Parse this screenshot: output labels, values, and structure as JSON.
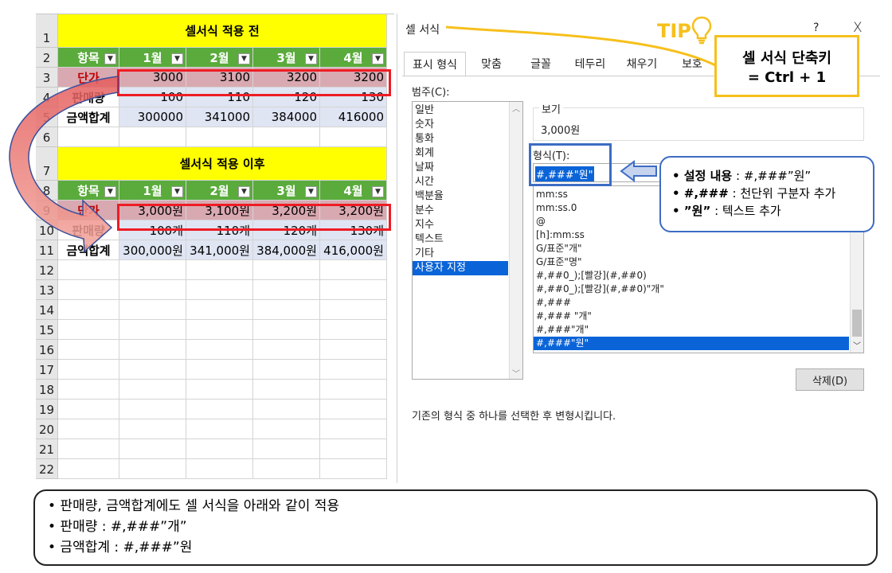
{
  "sheet": {
    "rows": [
      "1",
      "2",
      "3",
      "4",
      "5",
      "6",
      "7",
      "8",
      "9",
      "10",
      "11",
      "12",
      "13",
      "14",
      "15",
      "16",
      "17",
      "18",
      "19",
      "20",
      "21",
      "22"
    ],
    "before": {
      "title": "셀서식 적용 전",
      "headers": [
        "항목",
        "1월",
        "2월",
        "3월",
        "4월"
      ],
      "rows": [
        [
          "단가",
          "3000",
          "3100",
          "3200",
          "3200"
        ],
        [
          "판매량",
          "100",
          "110",
          "120",
          "130"
        ],
        [
          "금액합계",
          "300000",
          "341000",
          "384000",
          "416000"
        ]
      ]
    },
    "after": {
      "title": "셀서식 적용 이후",
      "headers": [
        "항목",
        "1월",
        "2월",
        "3월",
        "4월"
      ],
      "rows": [
        [
          "단가",
          "3,000원",
          "3,100원",
          "3,200원",
          "3,200원"
        ],
        [
          "판매량",
          "100개",
          "110개",
          "120개",
          "130개"
        ],
        [
          "금액합계",
          "300,000원",
          "341,000원",
          "384,000원",
          "416,000원"
        ]
      ]
    },
    "colors": {
      "title_bg": "#ffff00",
      "header_bg": "#5aab3c",
      "value_bg": "#dfe5f3",
      "highlight_bg": "#d9a9b1",
      "accent_red": "#ee1c24"
    }
  },
  "dialog": {
    "title": "셀 서식",
    "help": "?",
    "close": "X",
    "tabs": [
      "표시 형식",
      "맞춤",
      "글꼴",
      "테두리",
      "채우기",
      "보호"
    ],
    "category_label": "범주(C):",
    "categories": [
      "일반",
      "숫자",
      "통화",
      "회계",
      "날짜",
      "시간",
      "백분율",
      "분수",
      "지수",
      "텍스트",
      "기타",
      "사용자 지정"
    ],
    "selected_category": "사용자 지정",
    "preview_label": "보기",
    "preview_value": "3,000원",
    "format_label": "형식(T):",
    "format_value": "#,###\"원\"",
    "formats": [
      "mm:ss",
      "mm:ss.0",
      "@",
      "[h]:mm:ss",
      "G/표준\"개\"",
      "G/표준\"명\"",
      "#,##0_);[빨강](#,##0)",
      "#,##0_);[빨강](#,##0)\"개\"",
      "#,###",
      "#,### \"개\"",
      "#,###\"개\"",
      "#,###\"원\""
    ],
    "selected_format": "#,###\"원\"",
    "delete_button": "삭제(D)",
    "description": "기존의 형식 중 하나를 선택한 후 변형시킵니다."
  },
  "tip": {
    "label": "TIP",
    "box_title": "셀 서식 단축키",
    "box_value": "= Ctrl + 1"
  },
  "callout": {
    "items": [
      {
        "bold": "설정 내용",
        "text": " : #,###”원”"
      },
      {
        "bold": "#,###",
        "text": " : 천단위 구분자 추가"
      },
      {
        "bold": "”원”",
        "text": " : 텍스트 추가"
      }
    ]
  },
  "note": {
    "lines": [
      "• 판매량, 금액합계에도 셀 서식을 아래와 같이 적용",
      "• 판매량 : #,###”개”",
      "• 금액합계 : #,###”원"
    ]
  }
}
